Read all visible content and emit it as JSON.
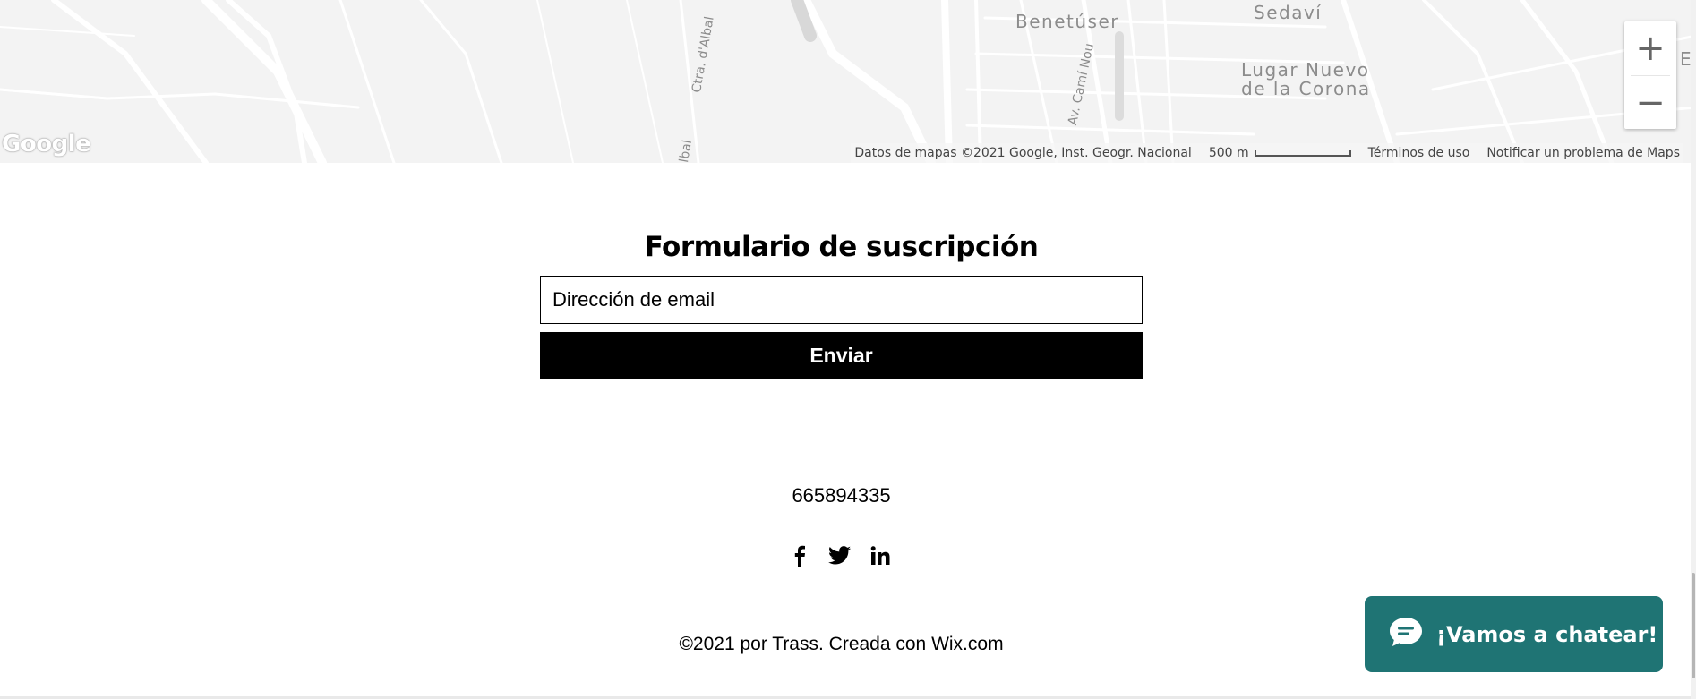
{
  "map": {
    "place_labels": [
      "Benetúser",
      "Sedaví",
      "Lugar Nuevo\nde la Corona"
    ],
    "road_labels": [
      "Ctra. d'Albal",
      "Av. Camí Nou",
      "lbal"
    ],
    "edge_letter": "E",
    "logo": "Google",
    "footer": {
      "data": "Datos de mapas ©2021 Google, Inst. Geogr. Nacional",
      "scale": "500 m",
      "terms": "Términos de uso",
      "report": "Notificar un problema de Maps"
    },
    "zoom_in": "+",
    "zoom_out": "−",
    "colors": {
      "background": "#f3f3f3",
      "roads": "#ffffff",
      "labels": "#8c8c8c"
    }
  },
  "form": {
    "title": "Formulario de suscripción",
    "email_placeholder": "Dirección de email",
    "email_value": "",
    "submit_label": "Enviar"
  },
  "footer": {
    "phone": "665894335",
    "social_icons": [
      "facebook-icon",
      "twitter-icon",
      "linkedin-icon"
    ],
    "copyright_prefix": "©2021 por Trass. Creada con ",
    "copyright_link": "Wix.com"
  },
  "chat": {
    "label": "¡Vamos a chatear!",
    "icon": "chat-bubble-icon",
    "color": "#1f7474"
  }
}
